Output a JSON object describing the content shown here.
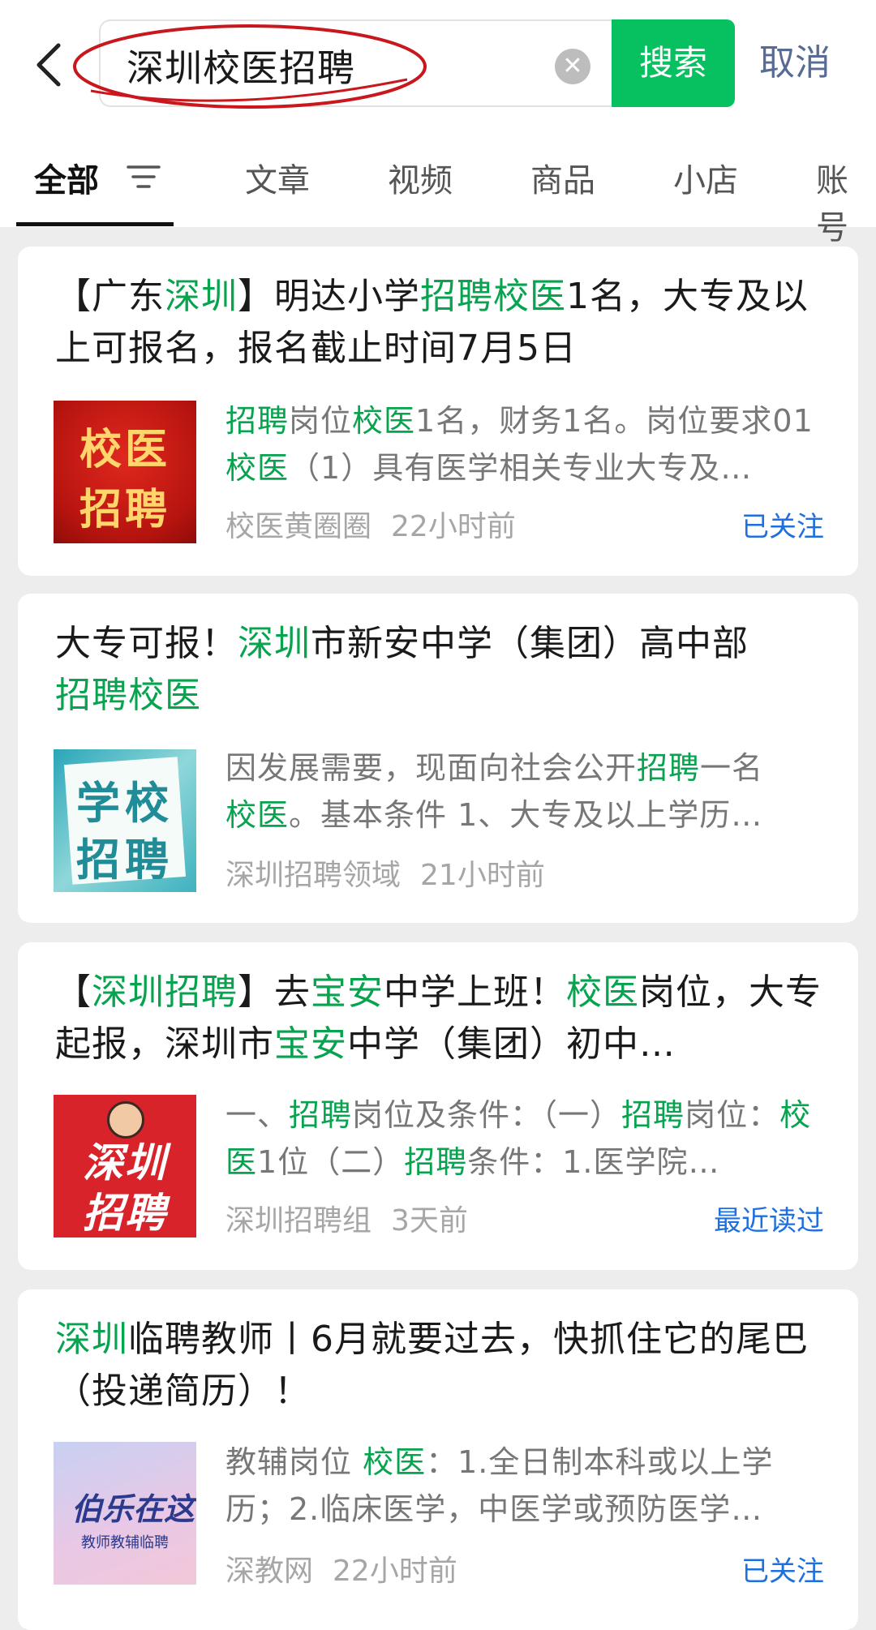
{
  "search": {
    "query": "深圳校医招聘",
    "button": "搜索",
    "cancel": "取消"
  },
  "tabs": [
    {
      "label": "全部"
    },
    {
      "label": "文章"
    },
    {
      "label": "视频"
    },
    {
      "label": "商品"
    },
    {
      "label": "小店"
    },
    {
      "label": "账号"
    }
  ],
  "results": [
    {
      "title_parts": [
        "【广东",
        "深圳",
        "】明达小学",
        "招聘",
        "校医",
        "1名，大专及以上可报名，报名截止时间7月5日"
      ],
      "snippet_parts": [
        "招聘",
        "岗位",
        "校医",
        "1名，财务1名。岗位要求01",
        "校医",
        "（1）具有医学相关专业大专及…"
      ],
      "thumb_text": [
        "校医",
        "招聘"
      ],
      "source": "校医黄圈圈",
      "time": "22小时前",
      "tag": "已关注"
    },
    {
      "title_parts": [
        "大专可报！",
        "深圳",
        "市新安中学（集团）高中部",
        "招聘",
        "校医"
      ],
      "snippet_parts": [
        "因发展需要，现面向社会公开",
        "招聘",
        "一名",
        "校医",
        "。基本条件 1、大专及以上学历…"
      ],
      "thumb_text": [
        "学校",
        "招聘"
      ],
      "source": "深圳招聘领域",
      "time": "21小时前",
      "tag": ""
    },
    {
      "title_parts": [
        "【",
        "深圳招聘",
        "】去",
        "宝安",
        "中学上班！",
        "校医",
        "岗位，大专起报，深圳市",
        "宝安",
        "中学（集团）初中…"
      ],
      "snippet_parts": [
        "一、",
        "招聘",
        "岗位及条件：（一）",
        "招聘",
        "岗位：",
        "校医",
        "1位（二）",
        "招聘",
        "条件：1.医学院…"
      ],
      "thumb_text": [
        "深圳",
        "招聘"
      ],
      "source": "深圳招聘组",
      "time": "3天前",
      "tag": "最近读过"
    },
    {
      "title_parts": [
        "深圳",
        "临聘教师丨6月就要过去，快抓住它的尾巴（投递简历）！"
      ],
      "snippet_parts": [
        "教辅岗位 ",
        "校医",
        "：1.全日制本科或以上学历；2.临床医学，中医学或预防医学…"
      ],
      "thumb_text": [
        "伯乐在这",
        "教师教辅临聘"
      ],
      "source": "深教网",
      "time": "22小时前",
      "tag": "已关注"
    }
  ],
  "colors": {
    "accent_green": "#07c160",
    "highlight_green": "#07a34f",
    "link_blue": "#1e6fe0",
    "cancel_blue": "#576b95"
  }
}
